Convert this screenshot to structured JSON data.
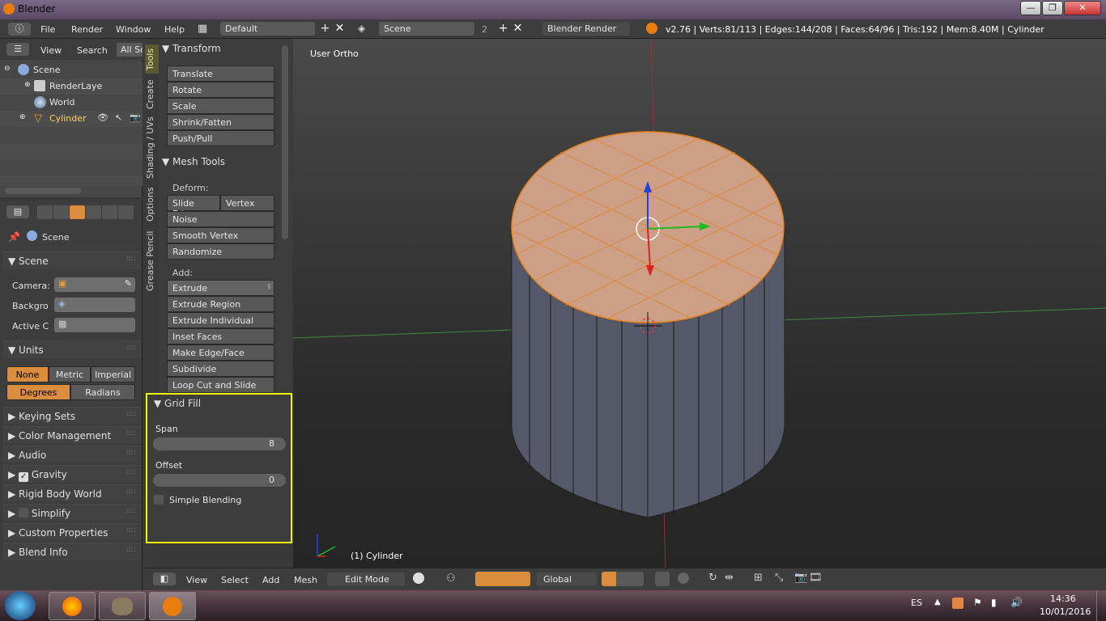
{
  "window": {
    "title": "Blender",
    "minimize": "—",
    "maximize": "❐",
    "close": "✕"
  },
  "info": {
    "menus": [
      "File",
      "Render",
      "Window",
      "Help"
    ],
    "layout": "Default",
    "scene": "Scene",
    "scene_count": "2",
    "engine": "Blender Render",
    "stats": "v2.76 | Verts:81/113 | Edges:144/208 | Faces:64/96 | Tris:192 | Mem:8.40M | Cylinder"
  },
  "outliner": {
    "view": "View",
    "search": "Search",
    "filter": "All Sc",
    "rows": [
      "Scene",
      "RenderLaye",
      "World",
      "Cylinder"
    ]
  },
  "properties": {
    "context": "Scene",
    "scene_panel": "Scene",
    "camera_label": "Camera:",
    "background_label": "Backgro",
    "active_clip_label": "Active C",
    "units_panel": "Units",
    "units": [
      "None",
      "Metric",
      "Imperial"
    ],
    "rotation": [
      "Degrees",
      "Radians"
    ],
    "collapsed": [
      "Keying Sets",
      "Color Management",
      "Audio",
      "Gravity",
      "Rigid Body World",
      "Simplify",
      "Custom Properties",
      "Blend Info"
    ]
  },
  "tabs": [
    "Tools",
    "Create",
    "Shading / UVs",
    "Options",
    "Grease Pencil"
  ],
  "tools": {
    "transform_hdr": "Transform",
    "transform": [
      "Translate",
      "Rotate",
      "Scale",
      "Shrink/Fatten",
      "Push/Pull"
    ],
    "mesh_hdr": "Mesh Tools",
    "deform_label": "Deform:",
    "slide_edge": "Slide Edge",
    "vertex": "Vertex",
    "deform": [
      "Noise",
      "Smooth Vertex",
      "Randomize"
    ],
    "add_label": "Add:",
    "add": [
      "Extrude",
      "Extrude Region",
      "Extrude Individual",
      "Inset Faces",
      "Make Edge/Face",
      "Subdivide",
      "Loop Cut and Slide"
    ]
  },
  "gridfill": {
    "title": "Grid Fill",
    "span_label": "Span",
    "span": "8",
    "offset_label": "Offset",
    "offset": "0",
    "blending": "Simple Blending"
  },
  "viewport": {
    "view_label": "User Ortho",
    "object_label": "(1) Cylinder",
    "menus": [
      "View",
      "Select",
      "Add",
      "Mesh"
    ],
    "mode": "Edit Mode",
    "orientation": "Global"
  },
  "taskbar": {
    "lang": "ES",
    "time": "14:36",
    "date": "10/01/2016"
  },
  "colors": {
    "accent": "#e87d0d",
    "highlight": "#f2f200",
    "selected": "#d98d3d"
  }
}
